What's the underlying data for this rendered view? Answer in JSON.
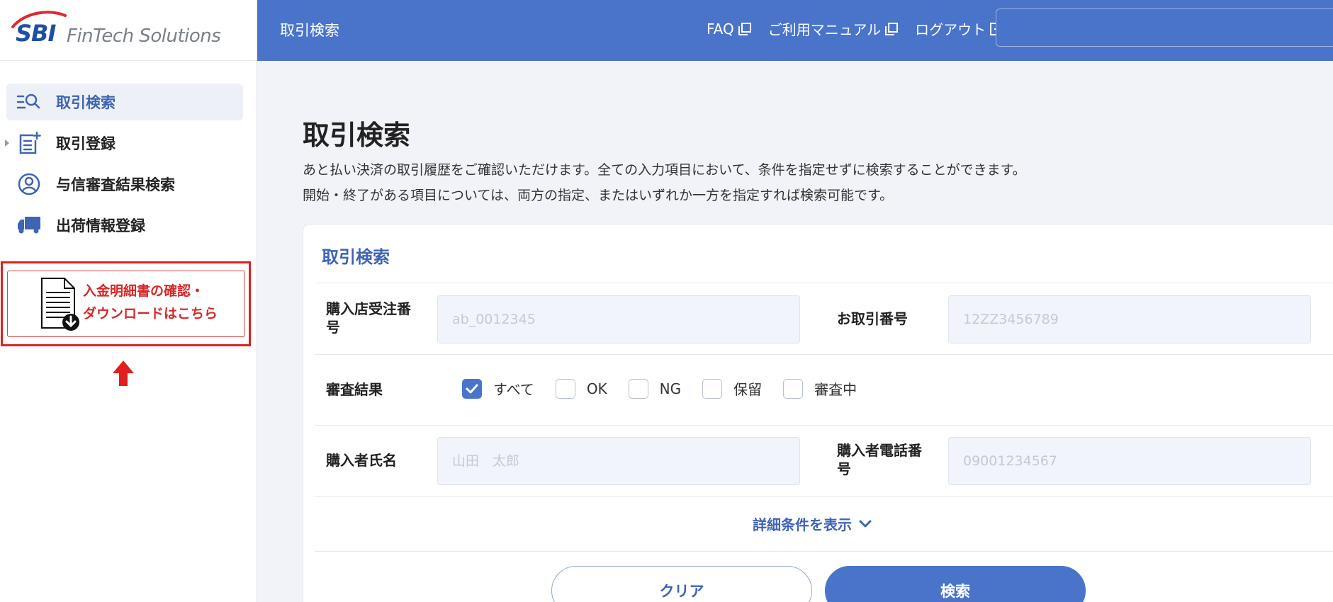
{
  "logo": {
    "brand": "SBI",
    "subtitle": "FinTech Solutions"
  },
  "sidebar": {
    "items": [
      {
        "label": "取引検索",
        "icon": "search-list-icon",
        "active": true
      },
      {
        "label": "取引登録",
        "icon": "add-document-icon",
        "active": false
      },
      {
        "label": "与信審査結果検索",
        "icon": "user-search-icon",
        "active": false
      },
      {
        "label": "出荷情報登録",
        "icon": "truck-icon",
        "active": false
      }
    ],
    "promo": {
      "line1": "入金明細書の確認・",
      "line2": "ダウンロードはこちら",
      "icon": "document-download-icon"
    }
  },
  "header": {
    "title": "取引検索",
    "links": [
      {
        "label": "FAQ",
        "icon": "external-link-icon"
      },
      {
        "label": "ご利用マニュアル",
        "icon": "external-link-icon"
      },
      {
        "label": "ログアウト",
        "icon": "logout-icon"
      }
    ]
  },
  "main": {
    "title": "取引検索",
    "description_line1": "あと払い決済の取引履歴をご確認いただけます。全ての入力項目において、条件を指定せずに検索することができます。",
    "description_line2": "開始・終了がある項目については、両方の指定、またはいずれか一方を指定すれば検索可能です。",
    "card_title": "取引検索",
    "fields": {
      "order_number": {
        "label_line1": "購入店受注番",
        "label_line2": "号",
        "value": "",
        "placeholder": "ab_0012345"
      },
      "transaction_number": {
        "label": "お取引番号",
        "value": "",
        "placeholder": "12ZZ3456789"
      },
      "review_result": {
        "label": "審査結果",
        "options": [
          {
            "label": "すべて",
            "checked": true
          },
          {
            "label": "OK",
            "checked": false
          },
          {
            "label": "NG",
            "checked": false
          },
          {
            "label": "保留",
            "checked": false
          },
          {
            "label": "審査中",
            "checked": false
          }
        ]
      },
      "buyer_name": {
        "label": "購入者氏名",
        "value": "",
        "placeholder": "山田　太郎"
      },
      "buyer_phone": {
        "label_line1": "購入者電話番",
        "label_line2": "号",
        "value": "",
        "placeholder": "09001234567"
      }
    },
    "more_conditions": "詳細条件を表示",
    "buttons": {
      "clear": "クリア",
      "search": "検索"
    }
  },
  "colors": {
    "primary": "#4a74c9",
    "accent_text": "#3e64b3",
    "promo_red": "#d62828"
  }
}
